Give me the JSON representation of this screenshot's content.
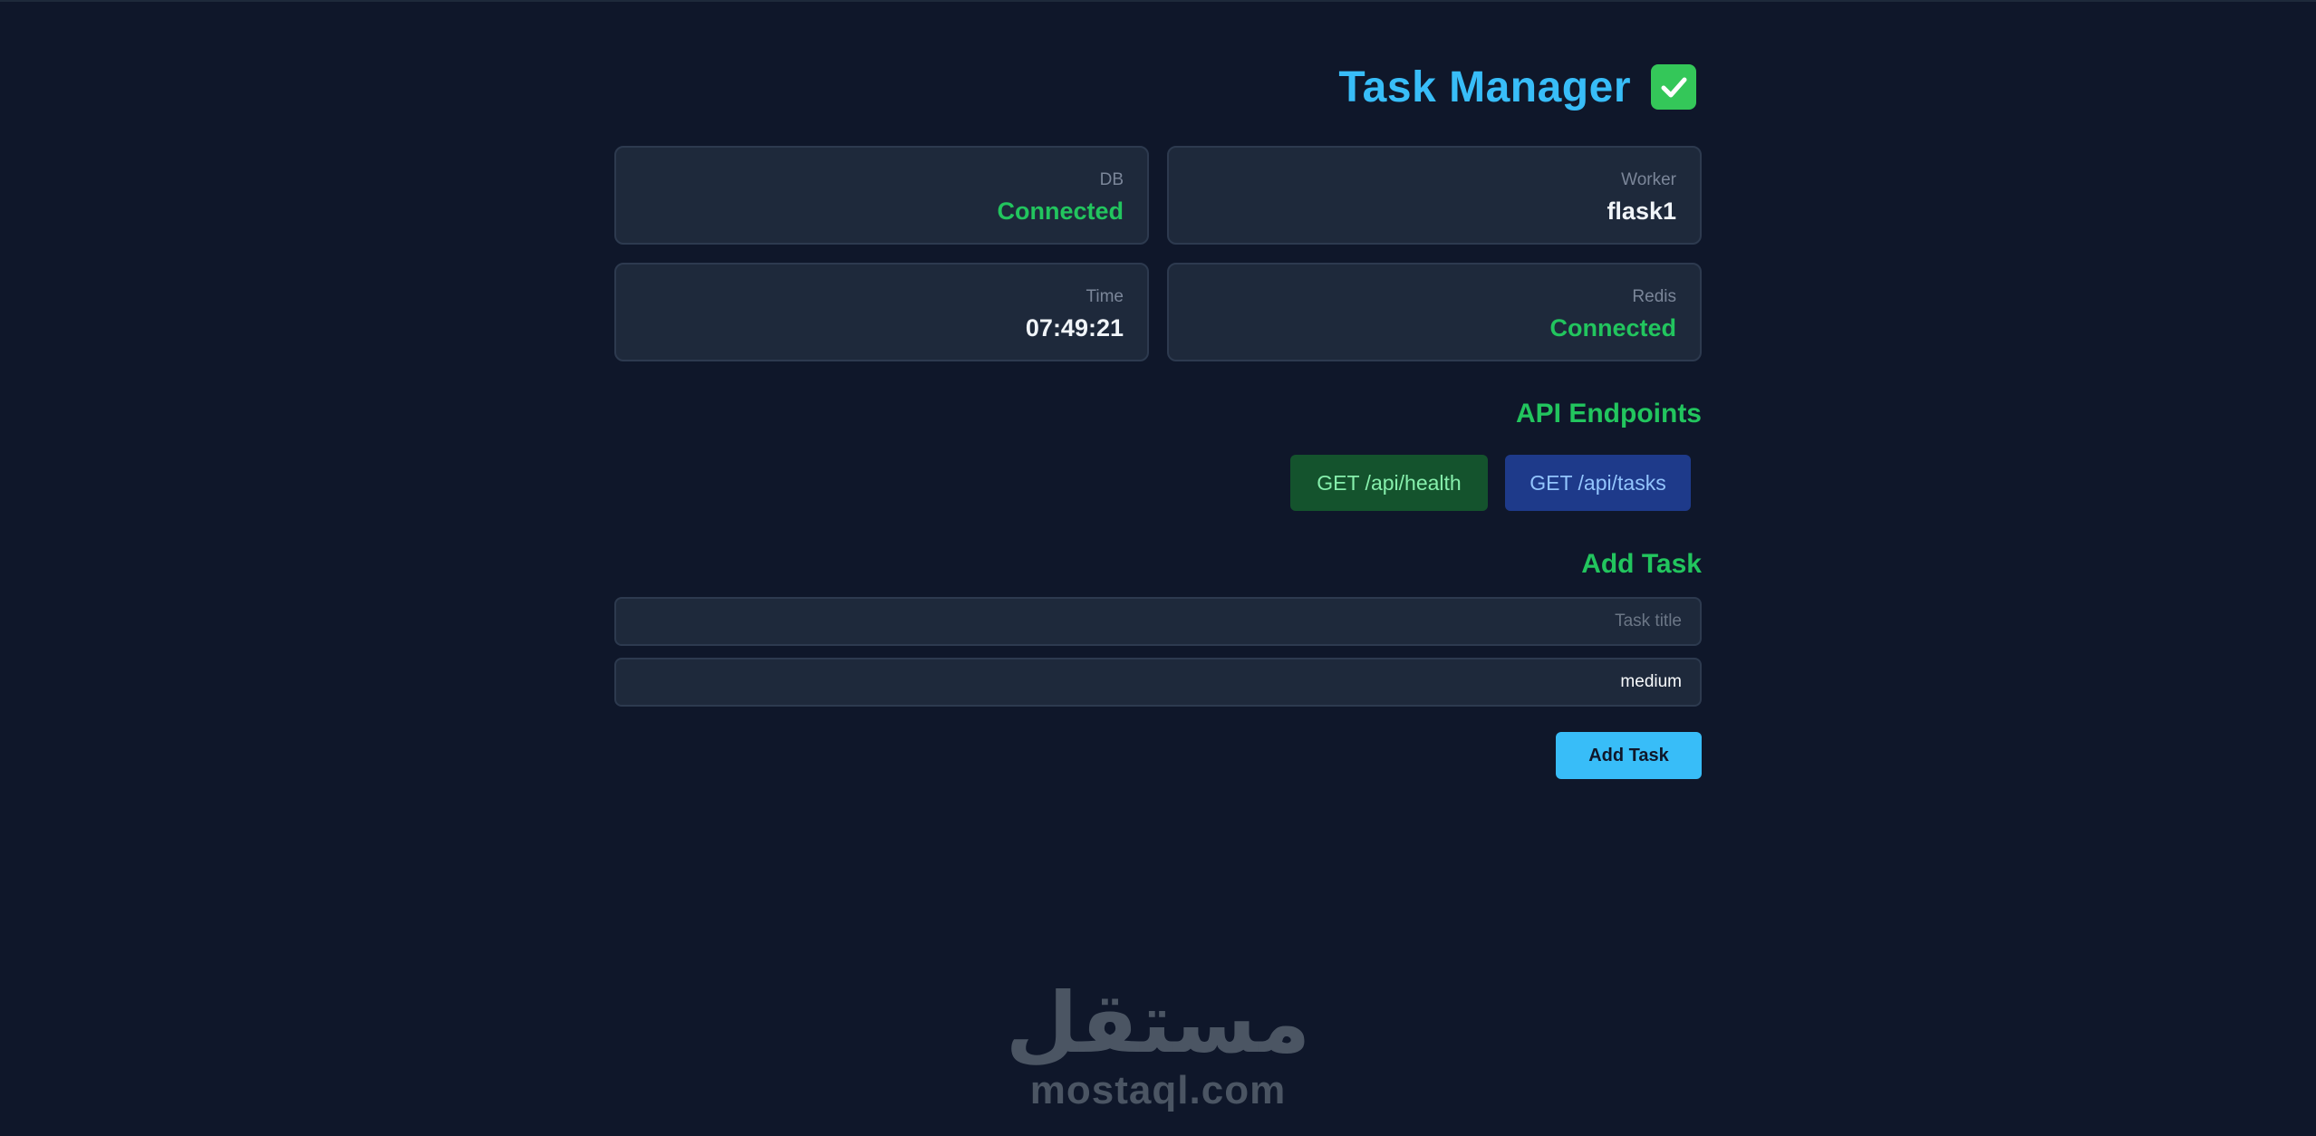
{
  "header": {
    "title": "Task Manager",
    "icon": "check-icon"
  },
  "status_cards": [
    {
      "label": "DB",
      "value": "Connected",
      "value_color": "#22c55e"
    },
    {
      "label": "Worker",
      "value": "flask1",
      "value_color": "#f1f5f9"
    },
    {
      "label": "Time",
      "value": "07:49:21",
      "value_color": "#f1f5f9"
    },
    {
      "label": "Redis",
      "value": "Connected",
      "value_color": "#22c55e"
    }
  ],
  "api": {
    "title": "API Endpoints",
    "buttons": [
      {
        "label": "GET /api/health"
      },
      {
        "label": "GET /api/tasks"
      }
    ]
  },
  "add_task": {
    "title": "Add Task",
    "title_placeholder": "Task title",
    "priority_value": "medium",
    "submit_label": "Add Task"
  },
  "watermark": {
    "arabic": "مستقل",
    "latin": "mostaql.com"
  },
  "colors": {
    "background": "#0f172a",
    "card": "#1e293b",
    "accent_blue": "#38bdf8",
    "accent_green": "#22c55e"
  }
}
